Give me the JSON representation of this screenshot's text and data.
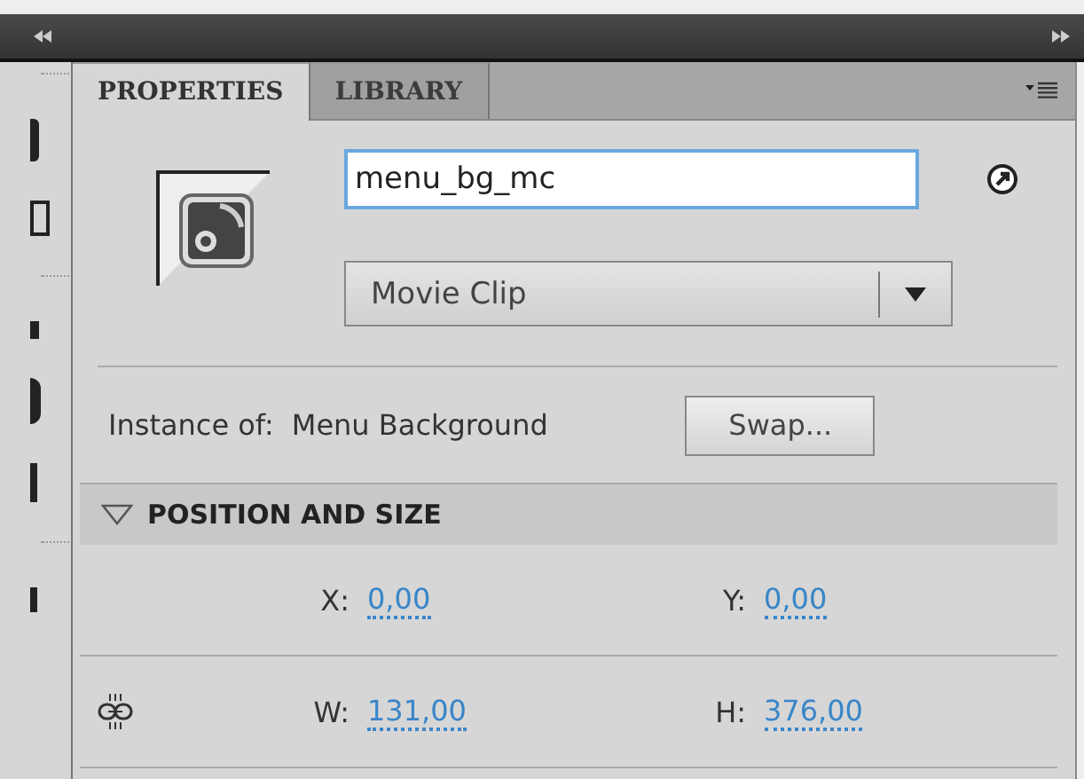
{
  "tabs": [
    {
      "label": "PROPERTIES",
      "selected": true
    },
    {
      "label": "LIBRARY",
      "selected": false
    }
  ],
  "instance_name": {
    "value": "menu_bg_mc"
  },
  "symbol_type": {
    "value": "Movie Clip"
  },
  "instance_of": {
    "label": "Instance of:",
    "value": "Menu Background",
    "button": "Swap..."
  },
  "section": {
    "title": "POSITION AND SIZE",
    "expanded": true
  },
  "fields": [
    {
      "label": "X:",
      "value": "0,00"
    },
    {
      "label": "Y:",
      "value": "0,00"
    },
    {
      "label": "W:",
      "value": "131,00"
    },
    {
      "label": "H:",
      "value": "376,00"
    }
  ]
}
